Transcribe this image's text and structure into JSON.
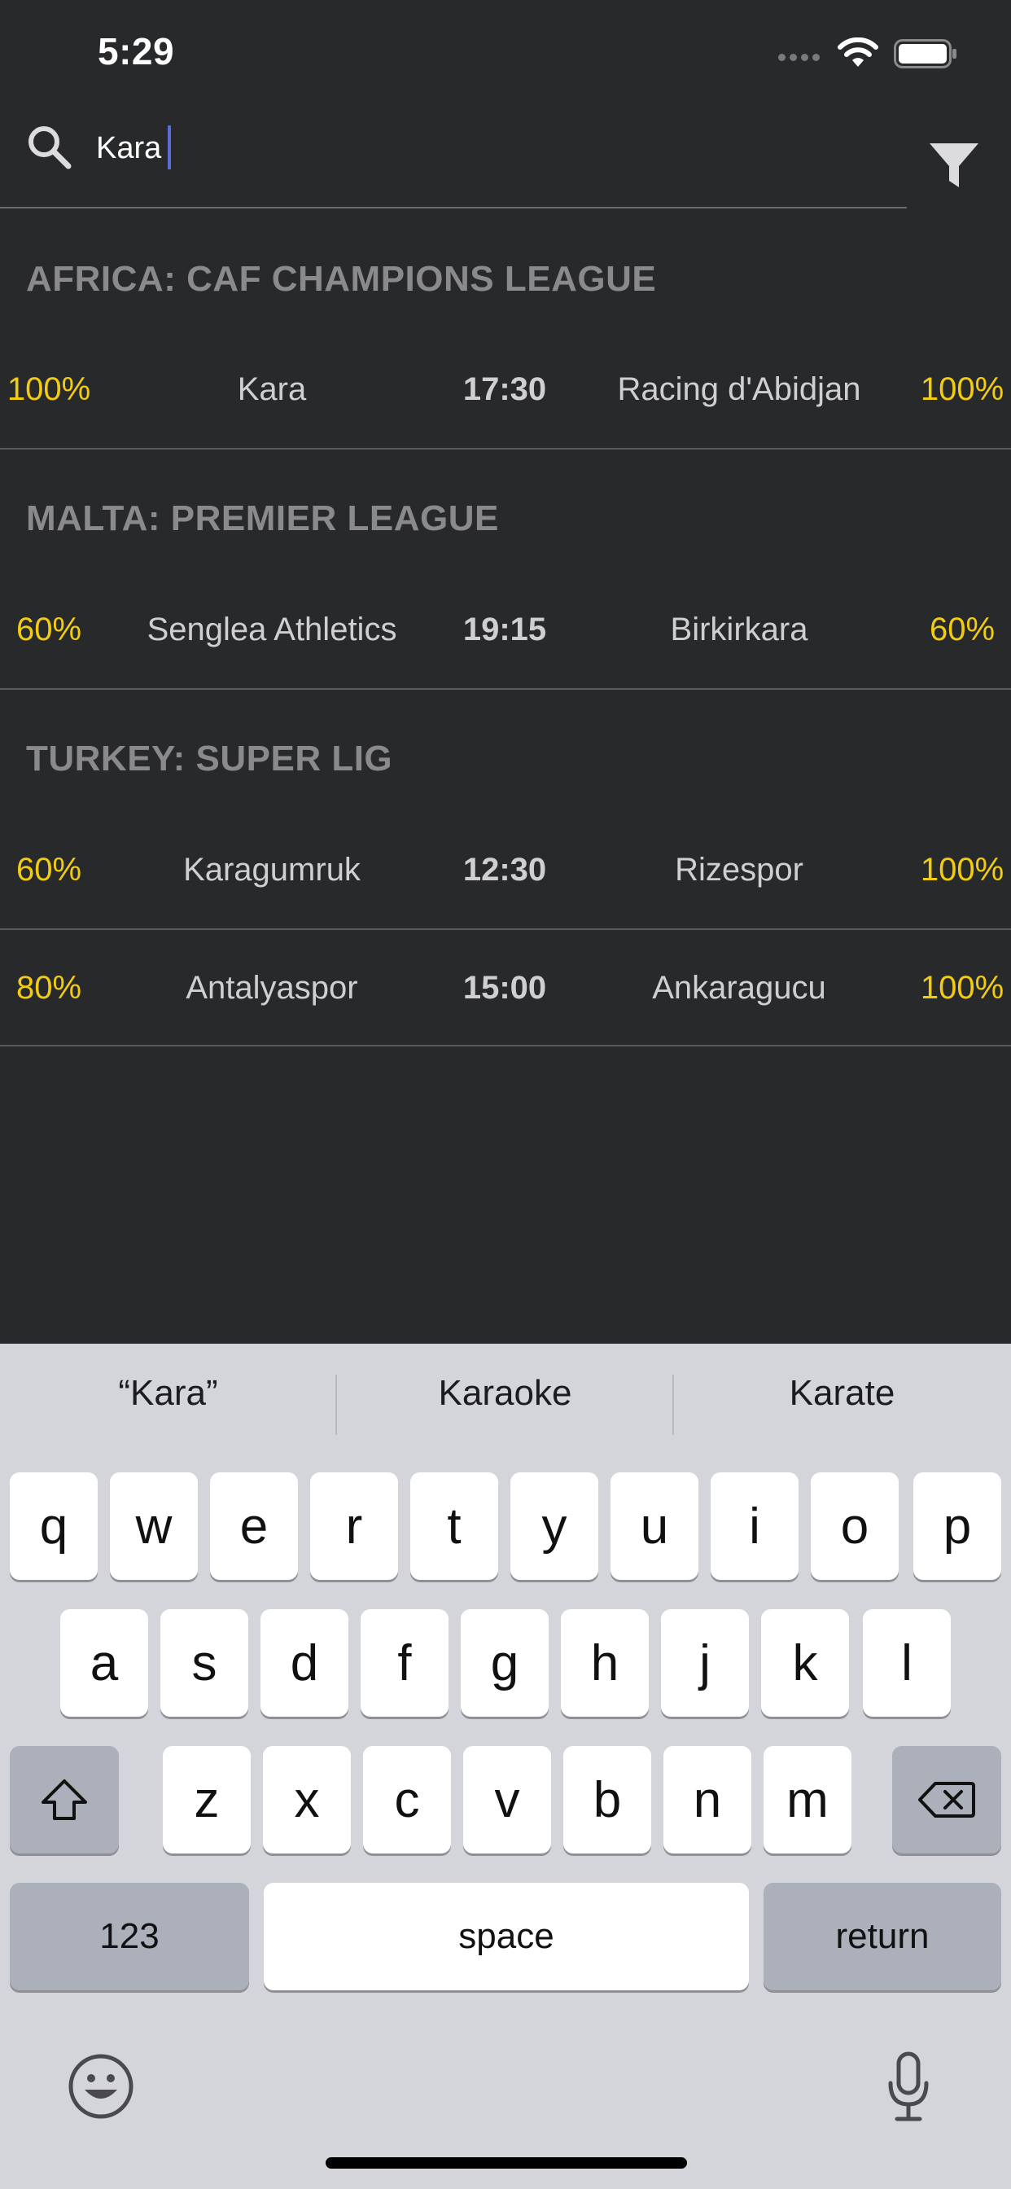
{
  "status": {
    "time": "5:29"
  },
  "search": {
    "value": "Kara"
  },
  "leagues": [
    {
      "name": "AFRICA: CAF CHAMPIONS LEAGUE",
      "matches": [
        {
          "home_pct": "100%",
          "home": "Kara",
          "time": "17:30",
          "away": "Racing d'Abidjan",
          "away_pct": "100%"
        }
      ]
    },
    {
      "name": "MALTA: PREMIER LEAGUE",
      "matches": [
        {
          "home_pct": "60%",
          "home": "Senglea Athletics",
          "time": "19:15",
          "away": "Birkirkara",
          "away_pct": "60%"
        }
      ]
    },
    {
      "name": "TURKEY: SUPER LIG",
      "matches": [
        {
          "home_pct": "60%",
          "home": "Karagumruk",
          "time": "12:30",
          "away": "Rizespor",
          "away_pct": "100%"
        },
        {
          "home_pct": "80%",
          "home": "Antalyaspor",
          "time": "15:00",
          "away": "Ankaragucu",
          "away_pct": "100%"
        }
      ]
    }
  ],
  "keyboard": {
    "suggestions": [
      "“Kara”",
      "Karaoke",
      "Karate"
    ],
    "row1": [
      "q",
      "w",
      "e",
      "r",
      "t",
      "y",
      "u",
      "i",
      "o",
      "p"
    ],
    "row2": [
      "a",
      "s",
      "d",
      "f",
      "g",
      "h",
      "j",
      "k",
      "l"
    ],
    "row3": [
      "z",
      "x",
      "c",
      "v",
      "b",
      "n",
      "m"
    ],
    "numbers_label": "123",
    "space_label": "space",
    "return_label": "return"
  },
  "colors": {
    "background": "#28292b",
    "percent": "#f2cc12",
    "league": "#8a8a8c"
  },
  "icons": [
    "search-icon",
    "filter-icon",
    "wifi-icon",
    "battery-icon",
    "shift-icon",
    "delete-icon",
    "emoji-icon",
    "microphone-icon"
  ]
}
